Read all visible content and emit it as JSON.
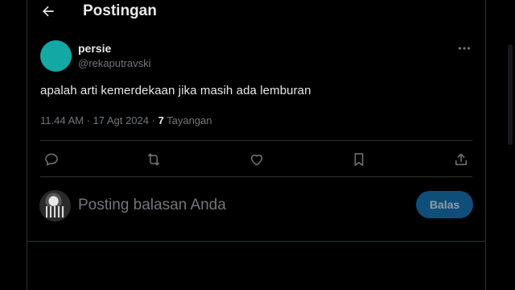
{
  "header": {
    "title": "Postingan"
  },
  "tweet": {
    "author": {
      "display_name": "persie",
      "handle": "@rekaputravski"
    },
    "text": "apalah arti kemerdekaan jika masih ada lemburan",
    "meta": {
      "time": "11.44 AM",
      "separator_1": " · ",
      "date": "17 Agt 2024",
      "separator_2": " · ",
      "views_count": "7",
      "views_label": " Tayangan"
    }
  },
  "reply": {
    "placeholder": "Posting balasan Anda",
    "button_label": "Balas"
  },
  "icons": {
    "back": "arrow-left-icon",
    "more": "more-horizontal-icon",
    "reply": "speech-bubble-icon",
    "repost": "repost-icon",
    "like": "heart-icon",
    "bookmark": "bookmark-icon",
    "share": "share-icon"
  },
  "colors": {
    "background": "#000000",
    "text": "#e7e9ea",
    "muted": "#71767b",
    "border": "#2f3336",
    "avatar": "#14a8a4",
    "button": "#0f4e78"
  }
}
